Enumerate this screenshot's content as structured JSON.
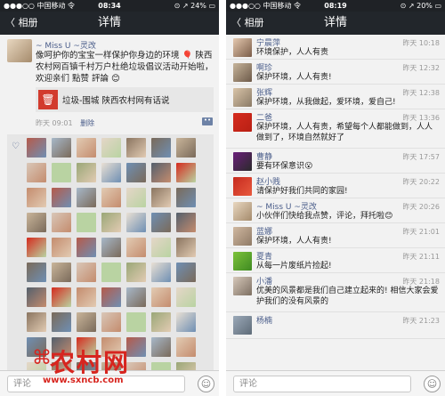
{
  "left": {
    "status": {
      "carrier": "●●●○○ 中国移动 令",
      "time": "08:34",
      "battery": "⊙ ↗ 24% ▭"
    },
    "nav": {
      "back": "〈 相册",
      "title": "详情"
    },
    "post": {
      "author": "~ Miss U ~灵改",
      "text": "像呵护你的宝宝一样保护你身边的环境 🎈 陕西农村网百镇千村万户杜绝垃圾倡议活动开始啦，欢迎亲们 點赞 評論 😊",
      "link_title": "垃圾-围城 陕西农村网有话说",
      "time": "昨天 09:01",
      "delete": "删除"
    },
    "likes": {
      "heart": "♡",
      "count_shown": 70
    },
    "input_placeholder": "评论"
  },
  "right": {
    "status": {
      "carrier": "●●●○○ 中国移动 令",
      "time": "08:19",
      "battery": "⊙ ↗ 20% ▭"
    },
    "nav": {
      "back": "〈 相册",
      "title": "详情"
    },
    "comments": [
      {
        "name": "宁晨萍",
        "time": "昨天 10:18",
        "text": "环境保护，人人有责"
      },
      {
        "name": "啊珍",
        "time": "昨天 12:32",
        "text": "保护环境，人人有责!"
      },
      {
        "name": "张辉",
        "time": "昨天 12:38",
        "text": "保护环境，从我做起，爱环境，爱自己!"
      },
      {
        "name": "二爸",
        "time": "昨天 13:36",
        "text": "保护环境，人人有责，希望每个人都能做到，人人做到了，环境自然就好了"
      },
      {
        "name": "曹静",
        "time": "昨天 17:57",
        "text": "要有环保意识😮"
      },
      {
        "name": "赵小贱",
        "time": "昨天 20:22",
        "text": "请保护好我们共同的家园!"
      },
      {
        "name": "~ Miss U ~灵改",
        "time": "昨天 20:26",
        "text": "小伙伴们快给我点赞，评论，拜托啦😊"
      },
      {
        "name": "蓝娜",
        "time": "昨天 21:01",
        "text": "保护环境，人人有责!"
      },
      {
        "name": "夏青",
        "time": "昨天 21:11",
        "text": "从每一片废纸片捡起!"
      },
      {
        "name": "小潘",
        "time": "昨天 21:18",
        "text": "优美的风景都是我们自己建立起来的! 相信大家会爱护我们的没有风景的"
      },
      {
        "name": "杨楠",
        "time": "昨天 21:23",
        "text": ""
      }
    ],
    "input_placeholder": "评论"
  },
  "watermark": {
    "brand": "农村网",
    "url": "www.sxncb.com"
  },
  "colors": {
    "navbar": "#22262b",
    "name_link": "#4a5d8a",
    "flag_red": "#d52b1e"
  }
}
